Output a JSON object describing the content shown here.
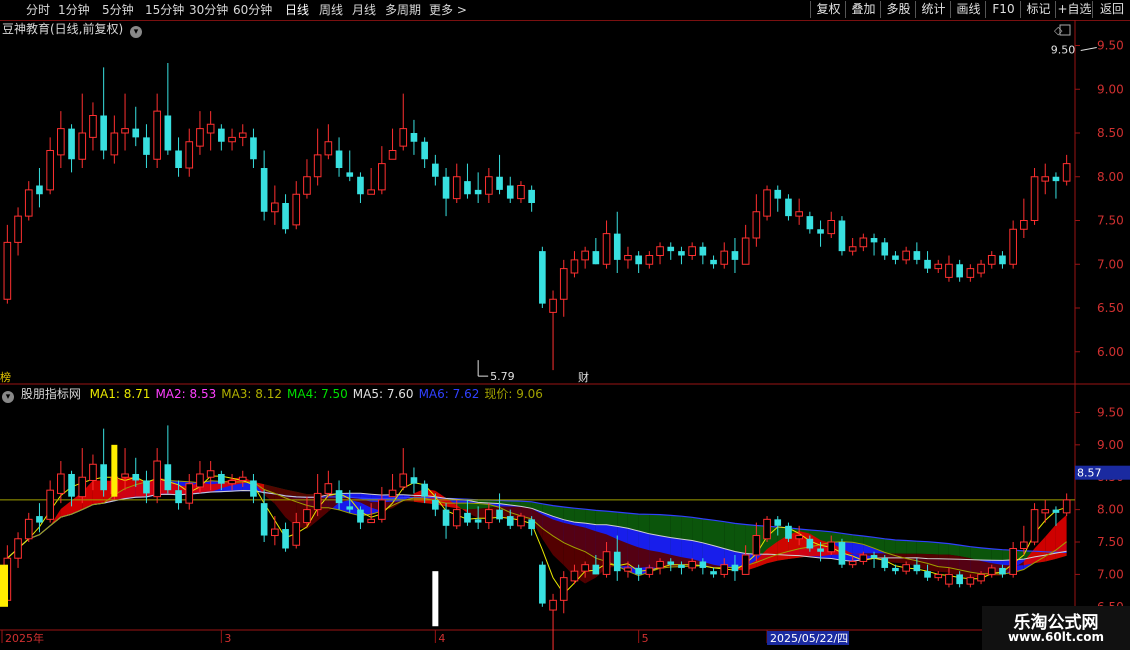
{
  "toolbar": {
    "periods": [
      "分时",
      "1分钟",
      "5分钟",
      "15分钟",
      "30分钟",
      "60分钟",
      "日线",
      "周线",
      "月线",
      "多周期",
      "更多"
    ],
    "active_period": "日线",
    "more_arrow": ">",
    "buttons": [
      "复权",
      "叠加",
      "多股",
      "统计",
      "画线",
      "F10",
      "标记",
      "+自选",
      "返回"
    ]
  },
  "main_panel": {
    "title": "豆神教育(日线,前复权)",
    "high_label": "9.50",
    "low_label": "5.79",
    "left_tag": "榜",
    "event_tag": "财"
  },
  "indicator_panel": {
    "name": "股朋指标网",
    "ma_labels": [
      {
        "text": "MA1: 8.71",
        "color": "#e8e800"
      },
      {
        "text": "MA2: 8.53",
        "color": "#ff40ff"
      },
      {
        "text": "MA3: 8.12",
        "color": "#b0b000"
      },
      {
        "text": "MA4: 7.50",
        "color": "#00e000"
      },
      {
        "text": "MA5: 7.60",
        "color": "#e0e0e0"
      },
      {
        "text": "MA6: 7.62",
        "color": "#3040ff"
      },
      {
        "text": "现价: 9.06",
        "color": "#a0a000"
      }
    ],
    "current_price_tag": "8.57"
  },
  "chart_data": {
    "type": "candlestick",
    "title": "豆神教育(日线,前复权)",
    "main_axis": {
      "ticks": [
        9.5,
        9.0,
        8.5,
        8.0,
        7.5,
        7.0,
        6.5,
        6.0
      ],
      "range": [
        5.7,
        9.7
      ]
    },
    "indicator_axis": {
      "ticks": [
        9.5,
        9.0,
        8.5,
        8.0,
        7.5,
        7.0,
        6.5
      ],
      "range": [
        6.25,
        9.8
      ]
    },
    "x_labels": [
      {
        "text": "2025年",
        "index": 0
      },
      {
        "text": "3",
        "index": 20
      },
      {
        "text": "4",
        "index": 40
      },
      {
        "text": "5",
        "index": 59
      },
      {
        "text": "2025/05/22/四",
        "index": 71
      },
      {
        "text": "7",
        "index": 97
      }
    ],
    "high_annotation": {
      "value": 9.5,
      "index": 102
    },
    "low_annotation": {
      "value": 5.79,
      "index": 44
    },
    "candles": [
      [
        6.6,
        7.25,
        7.45,
        6.55
      ],
      [
        7.25,
        7.55,
        7.65,
        7.1
      ],
      [
        7.55,
        7.85,
        7.95,
        7.5
      ],
      [
        7.9,
        7.8,
        8.1,
        7.65
      ],
      [
        7.85,
        8.3,
        8.45,
        7.8
      ],
      [
        8.25,
        8.55,
        8.75,
        8.1
      ],
      [
        8.55,
        8.2,
        8.6,
        8.05
      ],
      [
        8.2,
        8.5,
        8.95,
        8.1
      ],
      [
        8.45,
        8.7,
        8.85,
        8.3
      ],
      [
        8.7,
        8.3,
        9.25,
        8.2
      ],
      [
        8.25,
        8.5,
        8.7,
        8.15
      ],
      [
        8.5,
        8.55,
        8.95,
        8.3
      ],
      [
        8.55,
        8.45,
        8.8,
        8.35
      ],
      [
        8.45,
        8.25,
        8.6,
        8.1
      ],
      [
        8.2,
        8.75,
        8.95,
        8.1
      ],
      [
        8.7,
        8.3,
        9.3,
        8.25
      ],
      [
        8.3,
        8.1,
        8.45,
        8.0
      ],
      [
        8.1,
        8.4,
        8.55,
        8.0
      ],
      [
        8.35,
        8.55,
        8.75,
        8.25
      ],
      [
        8.5,
        8.6,
        8.75,
        8.3
      ],
      [
        8.55,
        8.4,
        8.6,
        8.3
      ],
      [
        8.4,
        8.45,
        8.55,
        8.3
      ],
      [
        8.45,
        8.5,
        8.6,
        8.35
      ],
      [
        8.45,
        8.2,
        8.55,
        8.1
      ],
      [
        8.1,
        7.6,
        8.3,
        7.5
      ],
      [
        7.6,
        7.7,
        7.9,
        7.45
      ],
      [
        7.7,
        7.4,
        7.8,
        7.35
      ],
      [
        7.45,
        7.8,
        7.95,
        7.4
      ],
      [
        7.8,
        8.0,
        8.2,
        7.75
      ],
      [
        8.0,
        8.25,
        8.55,
        7.9
      ],
      [
        8.25,
        8.4,
        8.6,
        8.2
      ],
      [
        8.3,
        8.1,
        8.45,
        8.0
      ],
      [
        8.05,
        8.0,
        8.3,
        7.95
      ],
      [
        8.0,
        7.8,
        8.05,
        7.7
      ],
      [
        7.8,
        7.85,
        8.1,
        7.8
      ],
      [
        7.85,
        8.15,
        8.35,
        7.8
      ],
      [
        8.2,
        8.3,
        8.55,
        8.2
      ],
      [
        8.35,
        8.55,
        8.95,
        8.3
      ],
      [
        8.5,
        8.4,
        8.65,
        8.25
      ],
      [
        8.4,
        8.2,
        8.45,
        8.1
      ],
      [
        8.15,
        8.0,
        8.25,
        7.9
      ],
      [
        8.0,
        7.75,
        8.1,
        7.55
      ],
      [
        7.75,
        8.0,
        8.15,
        7.7
      ],
      [
        7.95,
        7.8,
        8.15,
        7.75
      ],
      [
        7.85,
        7.8,
        8.05,
        7.7
      ],
      [
        7.8,
        8.0,
        8.1,
        7.7
      ],
      [
        8.0,
        7.85,
        8.25,
        7.8
      ],
      [
        7.9,
        7.75,
        8.0,
        7.7
      ],
      [
        7.75,
        7.9,
        7.95,
        7.7
      ],
      [
        7.85,
        7.7,
        7.9,
        7.6
      ],
      [
        7.15,
        6.55,
        7.2,
        6.5
      ],
      [
        6.45,
        6.6,
        6.7,
        5.79
      ],
      [
        6.6,
        6.95,
        7.05,
        6.4
      ],
      [
        6.9,
        7.05,
        7.15,
        6.85
      ],
      [
        7.05,
        7.15,
        7.2,
        6.95
      ],
      [
        7.15,
        7.0,
        7.3,
        7.0
      ],
      [
        7.0,
        7.35,
        7.5,
        6.95
      ],
      [
        7.35,
        7.05,
        7.6,
        6.9
      ],
      [
        7.05,
        7.1,
        7.2,
        6.95
      ],
      [
        7.1,
        7.0,
        7.15,
        6.9
      ],
      [
        7.0,
        7.1,
        7.15,
        6.95
      ],
      [
        7.1,
        7.2,
        7.25,
        7.0
      ],
      [
        7.2,
        7.15,
        7.25,
        7.05
      ],
      [
        7.15,
        7.1,
        7.2,
        7.0
      ],
      [
        7.1,
        7.2,
        7.25,
        7.05
      ],
      [
        7.2,
        7.1,
        7.25,
        7.0
      ],
      [
        7.05,
        7.0,
        7.1,
        6.95
      ],
      [
        7.0,
        7.15,
        7.25,
        6.95
      ],
      [
        7.15,
        7.05,
        7.3,
        6.9
      ],
      [
        7.0,
        7.3,
        7.45,
        7.0
      ],
      [
        7.3,
        7.6,
        7.8,
        7.2
      ],
      [
        7.55,
        7.85,
        7.9,
        7.5
      ],
      [
        7.85,
        7.75,
        7.9,
        7.6
      ],
      [
        7.75,
        7.55,
        7.8,
        7.5
      ],
      [
        7.55,
        7.6,
        7.75,
        7.45
      ],
      [
        7.55,
        7.4,
        7.6,
        7.35
      ],
      [
        7.4,
        7.35,
        7.5,
        7.2
      ],
      [
        7.35,
        7.5,
        7.6,
        7.3
      ],
      [
        7.5,
        7.15,
        7.55,
        7.1
      ],
      [
        7.15,
        7.2,
        7.3,
        7.1
      ],
      [
        7.2,
        7.3,
        7.35,
        7.15
      ],
      [
        7.3,
        7.25,
        7.35,
        7.1
      ],
      [
        7.25,
        7.1,
        7.3,
        7.05
      ],
      [
        7.1,
        7.05,
        7.15,
        7.0
      ],
      [
        7.05,
        7.15,
        7.2,
        7.0
      ],
      [
        7.15,
        7.05,
        7.25,
        7.0
      ],
      [
        7.05,
        6.95,
        7.15,
        6.9
      ],
      [
        6.95,
        7.0,
        7.05,
        6.9
      ],
      [
        6.85,
        7.0,
        7.1,
        6.8
      ],
      [
        7.0,
        6.85,
        7.05,
        6.8
      ],
      [
        6.85,
        6.95,
        7.0,
        6.8
      ],
      [
        6.9,
        7.0,
        7.05,
        6.85
      ],
      [
        7.0,
        7.1,
        7.15,
        6.95
      ],
      [
        7.1,
        7.0,
        7.15,
        6.95
      ],
      [
        7.0,
        7.4,
        7.5,
        6.95
      ],
      [
        7.4,
        7.5,
        7.75,
        7.3
      ],
      [
        7.5,
        8.0,
        8.1,
        7.45
      ],
      [
        7.95,
        8.0,
        8.15,
        7.8
      ],
      [
        8.0,
        7.95,
        8.05,
        7.75
      ],
      [
        7.95,
        8.15,
        8.25,
        7.9
      ]
    ]
  }
}
